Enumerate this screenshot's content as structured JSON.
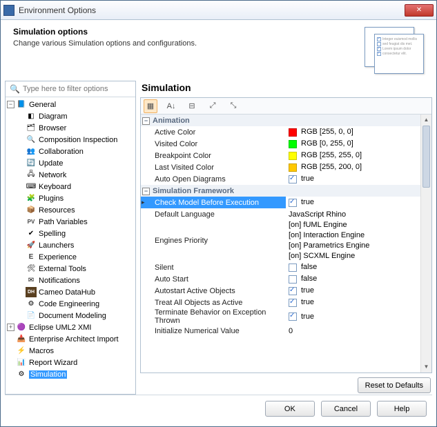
{
  "window": {
    "title": "Environment Options"
  },
  "header": {
    "title": "Simulation options",
    "subtitle": "Change various Simulation options and configurations."
  },
  "filter": {
    "placeholder": "Type here to filter options"
  },
  "tree": {
    "root1": "General",
    "items": [
      "Diagram",
      "Browser",
      "Composition Inspection",
      "Collaboration",
      "Update",
      "Network",
      "Keyboard",
      "Plugins",
      "Resources",
      "Path Variables",
      "Spelling",
      "Launchers",
      "Experience",
      "External Tools",
      "Notifications",
      "Cameo DataHub",
      "Code Engineering",
      "Document Modeling"
    ],
    "root2": "Eclipse UML2 XMI",
    "tail": [
      "Enterprise Architect Import",
      "Macros",
      "Report Wizard",
      "Simulation"
    ],
    "pathvar_prefix": "PV",
    "exp_prefix": "E",
    "dh_prefix": "DH"
  },
  "panel": {
    "title": "Simulation"
  },
  "groups": {
    "animation": "Animation",
    "framework": "Simulation Framework"
  },
  "props": {
    "animation": [
      {
        "name": "Active Color",
        "label": "RGB [255, 0, 0]",
        "color": "#ff0000"
      },
      {
        "name": "Visited Color",
        "label": "RGB [0, 255, 0]",
        "color": "#00ff00"
      },
      {
        "name": "Breakpoint Color",
        "label": "RGB [255, 255, 0]",
        "color": "#ffff00"
      },
      {
        "name": "Last Visited Color",
        "label": "RGB [255, 200, 0]",
        "color": "#ffc800"
      },
      {
        "name": "Auto Open Diagrams",
        "bool": true,
        "boolLabel": "true"
      }
    ],
    "framework": [
      {
        "name": "Check Model Before Execution",
        "bool": true,
        "boolLabel": "true",
        "selected": true
      },
      {
        "name": "Default Language",
        "text": "JavaScript Rhino"
      },
      {
        "name": "Engines Priority",
        "lines": [
          "[on] fUML Engine",
          "[on] Interaction Engine",
          "[on] Parametrics Engine",
          "[on] SCXML Engine"
        ]
      },
      {
        "name": "Silent",
        "bool": false,
        "boolLabel": "false"
      },
      {
        "name": "Auto Start",
        "bool": false,
        "boolLabel": "false"
      },
      {
        "name": "Autostart Active Objects",
        "bool": true,
        "boolLabel": "true"
      },
      {
        "name": "Treat All Objects as Active",
        "bool": true,
        "boolLabel": "true"
      },
      {
        "name": "Terminate Behavior on Exception Thrown",
        "bool": true,
        "boolLabel": "true"
      },
      {
        "name": "Initialize Numerical Value",
        "text": "0"
      }
    ]
  },
  "buttons": {
    "reset": "Reset to Defaults",
    "ok": "OK",
    "cancel": "Cancel",
    "help": "Help"
  }
}
